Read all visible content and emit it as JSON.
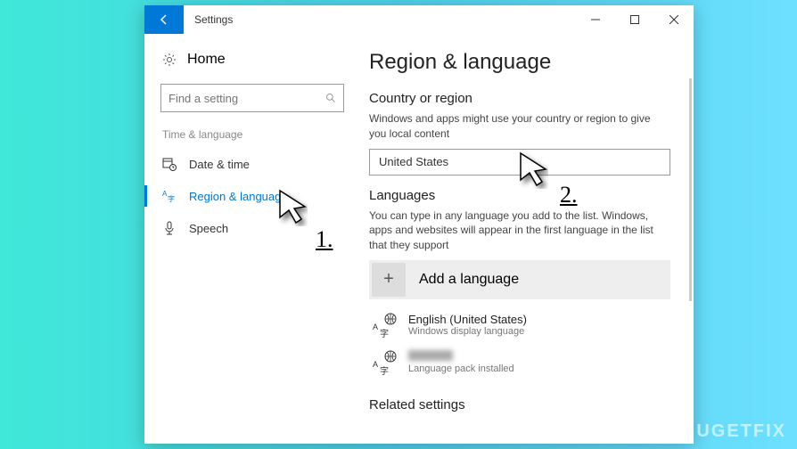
{
  "titlebar": {
    "title": "Settings"
  },
  "sidebar": {
    "home": "Home",
    "search_placeholder": "Find a setting",
    "category": "Time & language",
    "items": [
      {
        "label": "Date & time"
      },
      {
        "label": "Region & language"
      },
      {
        "label": "Speech"
      }
    ]
  },
  "main": {
    "heading": "Region & language",
    "section_country": "Country or region",
    "country_desc": "Windows and apps might use your country or region to give you local content",
    "country_value": "United States",
    "section_languages": "Languages",
    "languages_desc": "You can type in any language you add to the list. Windows, apps and websites will appear in the first language in the list that they support",
    "add_language": "Add a language",
    "langs": [
      {
        "name": "English (United States)",
        "sub": "Windows display language"
      },
      {
        "name": "",
        "sub": "Language pack installed"
      }
    ],
    "section_related": "Related settings"
  },
  "callouts": {
    "one": "1.",
    "two": "2."
  },
  "watermark": "UGETFIX"
}
